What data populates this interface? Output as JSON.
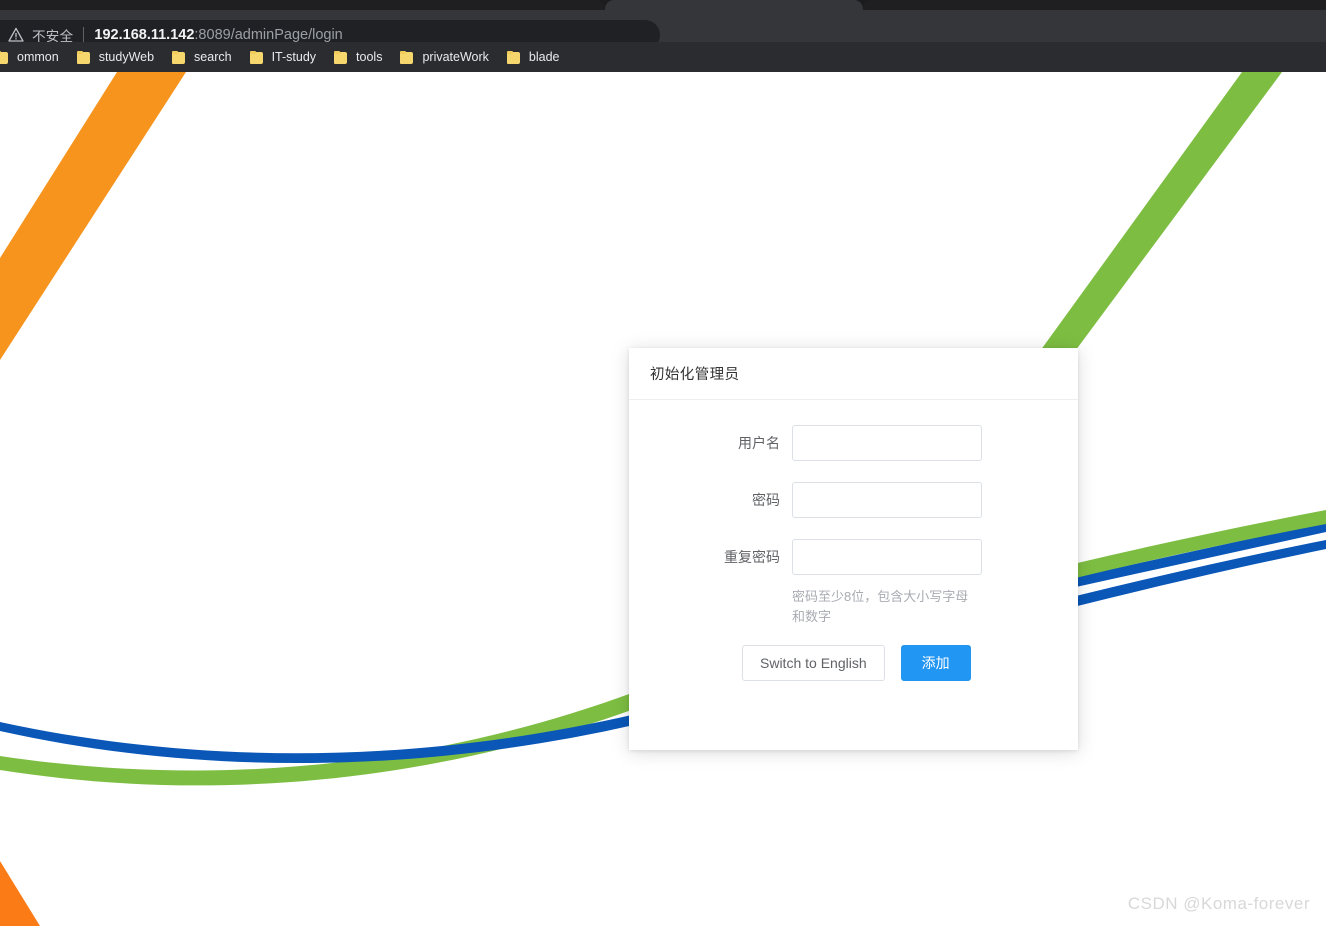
{
  "browser": {
    "tab_strip": {
      "active_tab_present": true
    },
    "omnibox": {
      "security_icon": "warning-triangle-icon",
      "security_label": "不安全",
      "url_host": "192.168.11.142",
      "url_rest": ":8089/adminPage/login"
    },
    "bookmarks": [
      {
        "icon": "folder-icon",
        "label": "ommon"
      },
      {
        "icon": "folder-icon",
        "label": "studyWeb"
      },
      {
        "icon": "folder-icon",
        "label": "search"
      },
      {
        "icon": "folder-icon",
        "label": "IT-study"
      },
      {
        "icon": "folder-icon",
        "label": "tools"
      },
      {
        "icon": "folder-icon",
        "label": "privateWork"
      },
      {
        "icon": "folder-icon",
        "label": "blade"
      }
    ]
  },
  "dialog": {
    "title": "初始化管理员",
    "fields": [
      {
        "label": "用户名",
        "value": "",
        "placeholder": "",
        "name": "username"
      },
      {
        "label": "密码",
        "value": "",
        "placeholder": "",
        "name": "password"
      },
      {
        "label": "重复密码",
        "value": "",
        "placeholder": "",
        "name": "repeat-password"
      }
    ],
    "hint": "密码至少8位，包含大小写字母和数字",
    "buttons": {
      "secondary": "Switch to English",
      "primary": "添加"
    }
  },
  "background": {
    "colors": {
      "orange": "#f7941e",
      "orange_solid": "#fb7b17",
      "green": "#7dbe42",
      "blue": "#0a57b8"
    }
  },
  "watermark": "CSDN @Koma-forever"
}
